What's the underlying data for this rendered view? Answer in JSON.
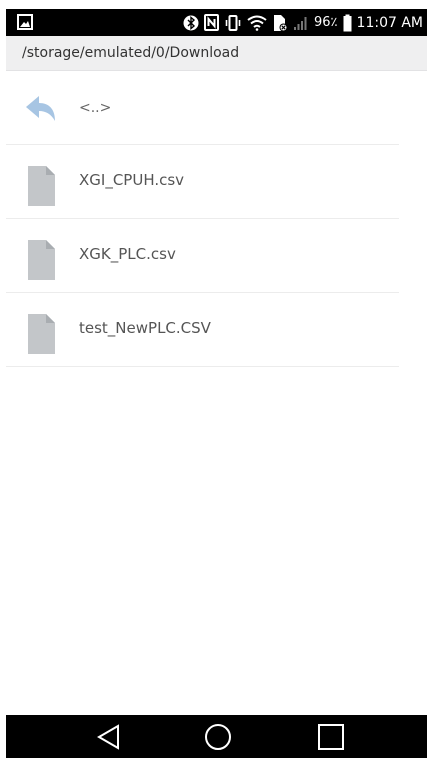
{
  "status_bar": {
    "battery_percent": "96٪",
    "time": "11:07 AM",
    "icons": [
      "image-icon",
      "bluetooth-icon",
      "nfc-icon",
      "vibrate-icon",
      "wifi-icon",
      "no-sim-icon",
      "signal-icon",
      "battery-icon"
    ]
  },
  "path_bar": {
    "path": "/storage/emulated/0/Download"
  },
  "file_list": {
    "items": [
      {
        "label": "<..>",
        "icon": "back-arrow-icon",
        "kind": "parent"
      },
      {
        "label": "XGI_CPUH.csv",
        "icon": "file-icon",
        "kind": "file"
      },
      {
        "label": "XGK_PLC.csv",
        "icon": "file-icon",
        "kind": "file"
      },
      {
        "label": "test_NewPLC.CSV",
        "icon": "file-icon",
        "kind": "file"
      }
    ]
  },
  "nav_bar": {
    "buttons": [
      "back-button",
      "home-button",
      "recents-button"
    ]
  },
  "colors": {
    "status_bar_bg": "#000000",
    "path_bar_bg": "#efeff0",
    "back_arrow": "#a7c5e3",
    "file_icon": "#c3c6c9",
    "file_icon_fold": "#a9adb1"
  }
}
